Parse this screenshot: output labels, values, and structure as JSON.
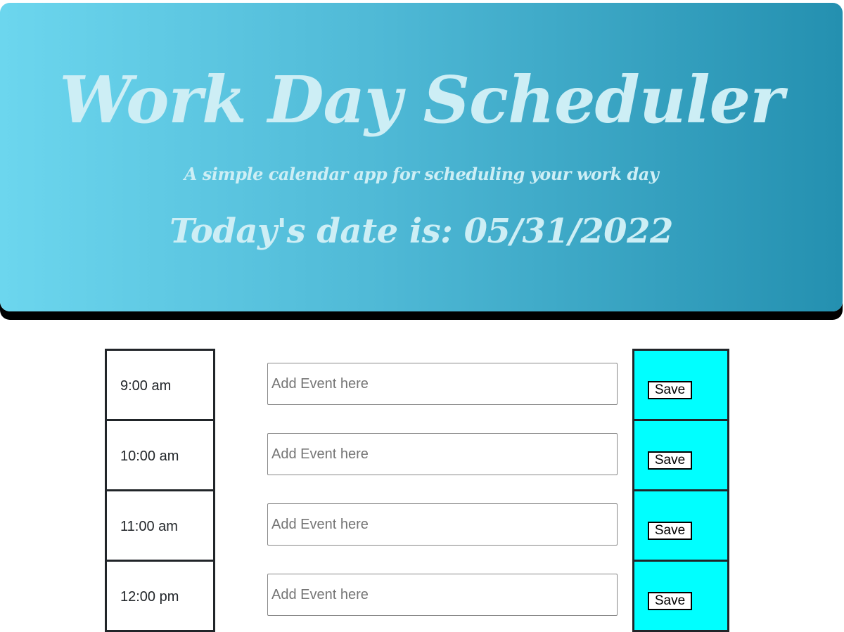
{
  "header": {
    "title": "Work Day Scheduler",
    "subtitle": "A simple calendar app for scheduling your work day",
    "today_label": "Today's date is: 05/31/2022"
  },
  "rows": [
    {
      "hour": "9:00 am",
      "placeholder": "Add Event here",
      "save_label": "Save"
    },
    {
      "hour": "10:00 am",
      "placeholder": "Add Event here",
      "save_label": "Save"
    },
    {
      "hour": "11:00 am",
      "placeholder": "Add Event here",
      "save_label": "Save"
    },
    {
      "hour": "12:00 pm",
      "placeholder": "Add Event here",
      "save_label": "Save"
    }
  ],
  "colors": {
    "header_gradient_start": "#6cd6ee",
    "header_gradient_end": "#2490b0",
    "header_text": "#cdeef5",
    "save_cell": "#00ffff"
  }
}
